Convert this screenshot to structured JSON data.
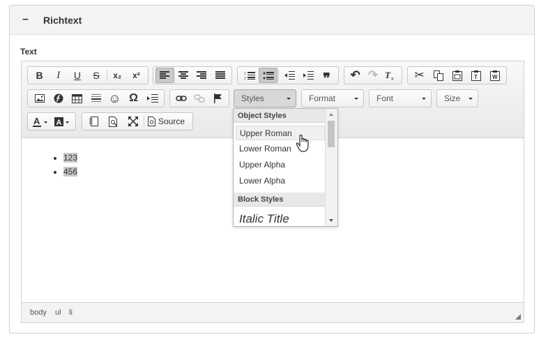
{
  "panel": {
    "title": "Richtext",
    "collapse_symbol": "–"
  },
  "field": {
    "label": "Text"
  },
  "toolbar": {
    "styles_label": "Styles",
    "format_label": "Format",
    "font_label": "Font",
    "size_label": "Size",
    "source_label": "Source"
  },
  "content": {
    "items": [
      "123",
      "456"
    ]
  },
  "statusbar": {
    "path": [
      "body",
      "ul",
      "li"
    ]
  },
  "styles_dropdown": {
    "group1": "Object Styles",
    "group2": "Block Styles",
    "items": [
      "Upper Roman",
      "Lower Roman",
      "Upper Alpha",
      "Lower Alpha"
    ],
    "block_item": "Italic Title"
  },
  "icons": {
    "bold": "B",
    "italic": "I",
    "underline": "U",
    "strike": "S",
    "subscript": "x₂",
    "superscript": "x²",
    "special_char": "Ω",
    "cut": "✂",
    "undo": "↶",
    "redo": "↷",
    "quote": "❞",
    "smiley": "☺"
  },
  "colors": {
    "toolbar_bg": "#f0f0f0",
    "selected_bg": "#c9c9c9",
    "highlight": "#c8c8c8"
  }
}
